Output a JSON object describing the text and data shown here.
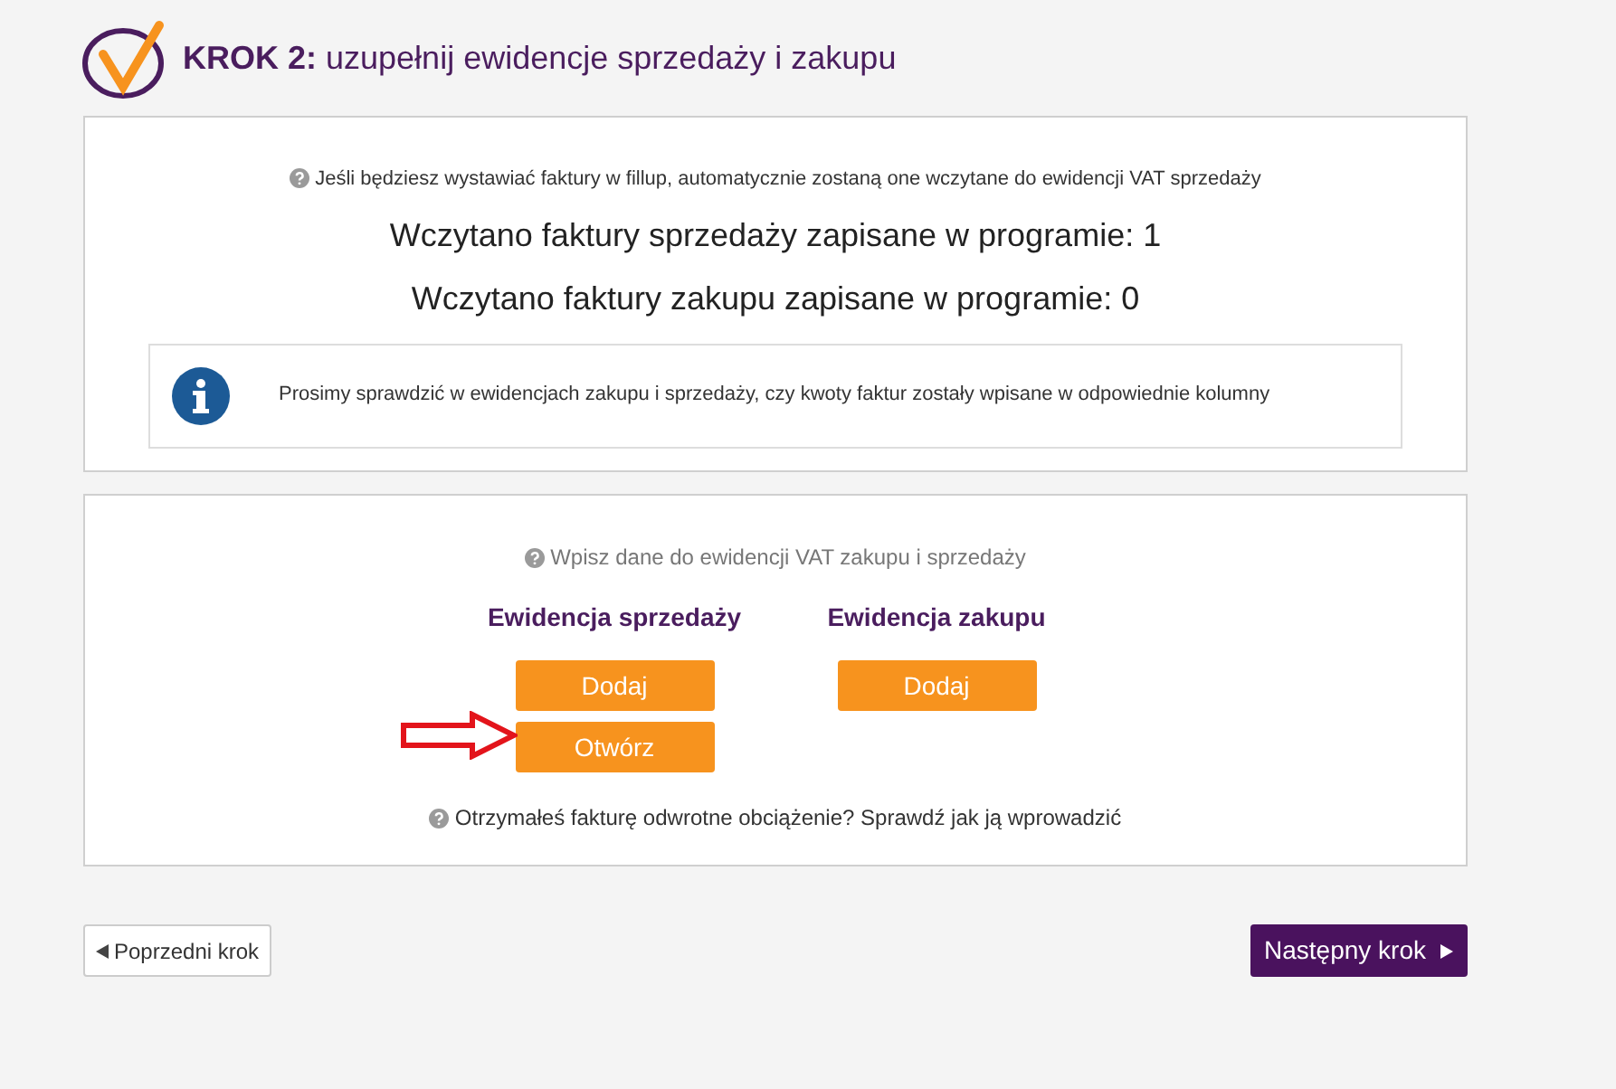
{
  "header": {
    "title": "**KROK 2:** uzupełnij ewidencje sprzedaży i zakupu"
  },
  "summary_panel": {
    "hint": "Jeśli będziesz wystawiać faktury w fillup, automatycznie zostaną one wczytane do ewidencji VAT sprzedaży",
    "counts": [
      "Wczytano faktury sprzedaży zapisane w programie: 1",
      "Wczytano faktury zakupu zapisane w programie: 0"
    ],
    "info": "Prosimy sprawdzić w ewidencjach zakupu i sprzedaży, czy kwoty faktur zostały wpisane w odpowiednie kolumny"
  },
  "entry_panel": {
    "hint": "Wpisz dane do ewidencji VAT zakupu i sprzedaży",
    "columns": [
      {
        "title": "Ewidencja sprzedaży",
        "buttons": [
          "Dodaj",
          "Otwórz"
        ]
      },
      {
        "title": "Ewidencja zakupu",
        "buttons": [
          "Dodaj"
        ]
      }
    ],
    "footer_hint": "Otrzymałeś fakturę odwrotne obciążenie? Sprawdź jak ją wprowadzić"
  },
  "nav": {
    "previous": "Poprzedni krok",
    "next": "Następny krok"
  }
}
